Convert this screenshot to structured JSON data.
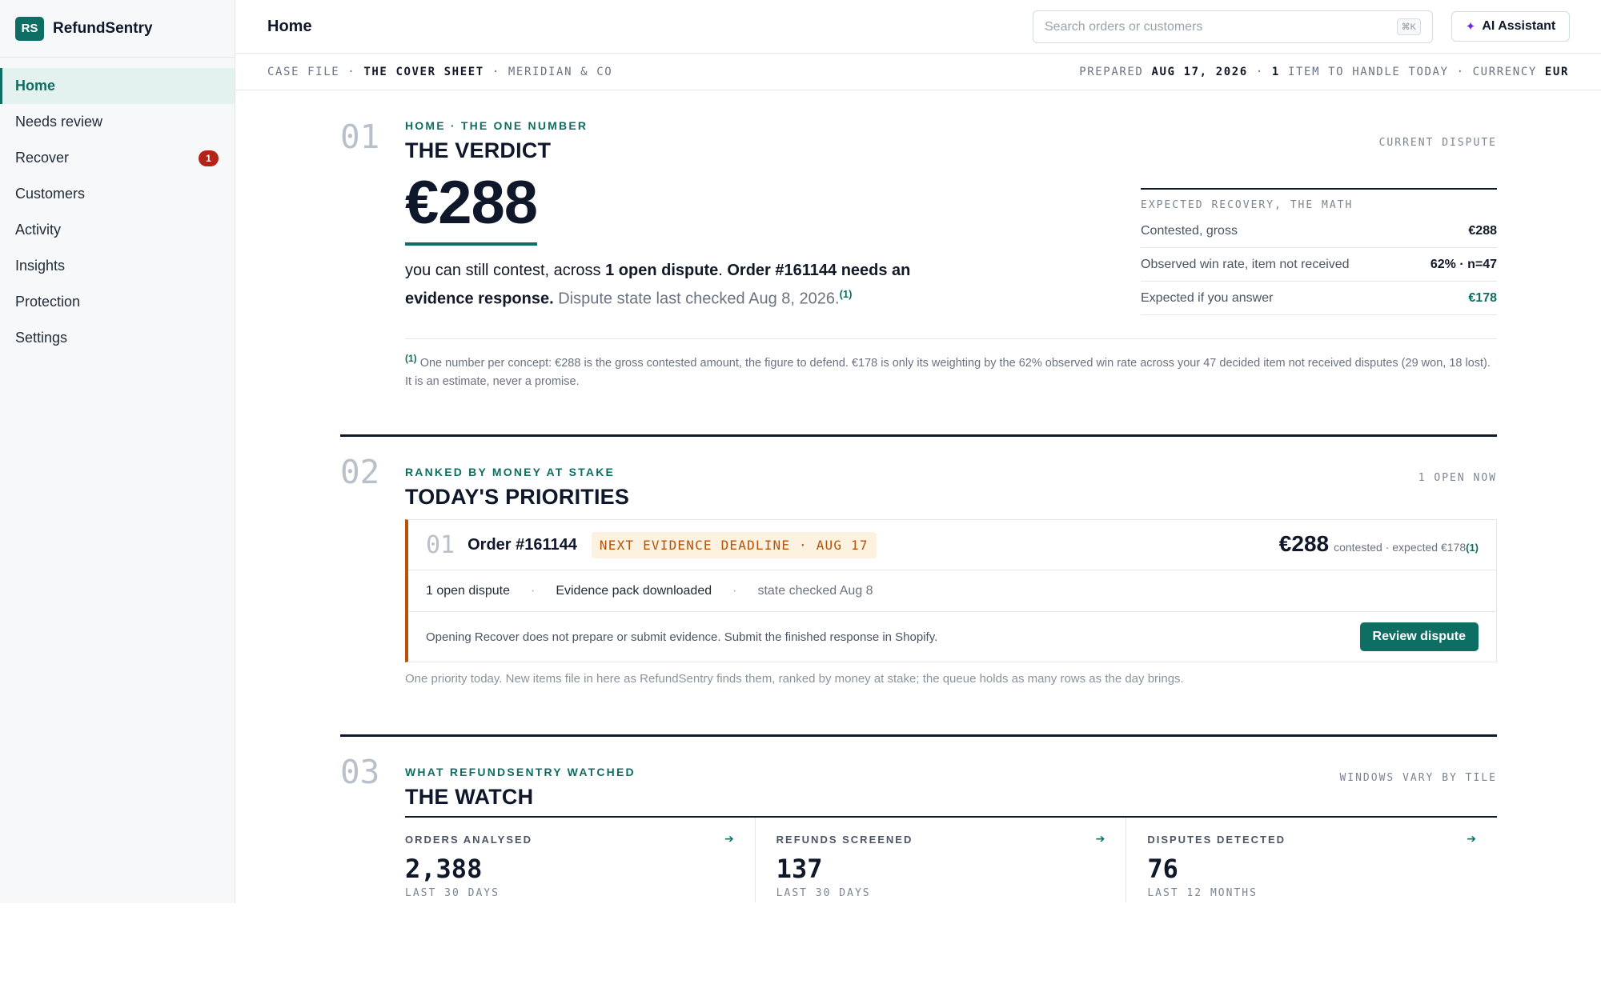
{
  "brand": {
    "logo": "RS",
    "name": "RefundSentry"
  },
  "sidebar": {
    "items": [
      {
        "label": "Home"
      },
      {
        "label": "Needs review"
      },
      {
        "label": "Recover",
        "badge": "1"
      },
      {
        "label": "Customers"
      },
      {
        "label": "Activity"
      },
      {
        "label": "Insights"
      },
      {
        "label": "Protection"
      },
      {
        "label": "Settings"
      }
    ]
  },
  "header": {
    "title": "Home",
    "search_placeholder": "Search orders or customers",
    "search_shortcut": "⌘K",
    "ai_label": "AI Assistant"
  },
  "strip": {
    "left_1": "CASE FILE · ",
    "left_2": "THE COVER SHEET",
    "left_3": " · MERIDIAN & CO",
    "right_1": "PREPARED ",
    "right_2": "AUG 17, 2026",
    "right_3": " · ",
    "right_4": "1",
    "right_5": " ITEM TO HANDLE TODAY · CURRENCY ",
    "right_6": "EUR"
  },
  "s1": {
    "num": "01",
    "eyebrow": "HOME · THE ONE NUMBER",
    "tag": "CURRENT DISPUTE",
    "title": "THE VERDICT",
    "amount": "€288",
    "text_1": "you can still contest, across ",
    "text_2": "1 open dispute",
    "text_3": ". ",
    "text_4": "Order #161144 needs an evidence response.",
    "text_5": " Dispute state last checked Aug 8, 2026.",
    "fn_mark": "(1)",
    "math": {
      "head": "EXPECTED RECOVERY, THE MATH",
      "rows": [
        {
          "label": "Contested, gross",
          "value": "€288"
        },
        {
          "label": "Observed win rate, item not received",
          "value": "62%  ·  n=47"
        },
        {
          "label": "Expected if you answer",
          "value": "€178"
        }
      ]
    },
    "footnote": " One number per concept: €288 is the gross contested amount, the figure to defend. €178 is only its weighting by the 62% observed win rate across your 47 decided item not received disputes (29 won, 18 lost). It is an estimate, never a promise."
  },
  "s2": {
    "num": "02",
    "eyebrow": "RANKED BY MONEY AT STAKE",
    "tag": "1 OPEN NOW",
    "title": "TODAY'S PRIORITIES",
    "card": {
      "rank": "01",
      "order": "Order #161144",
      "deadline": "NEXT EVIDENCE DEADLINE · AUG 17",
      "amount": "€288",
      "amount_note": "contested · expected €178",
      "fn_mark": "(1)",
      "meta_1": "1 open dispute",
      "meta_2": "Evidence pack downloaded",
      "meta_3": "state checked Aug 8",
      "sep": "·",
      "note": "Opening Recover does not prepare or submit evidence. Submit the finished response in Shopify.",
      "button": "Review dispute"
    },
    "footer": "One priority today. New items file in here as RefundSentry finds them, ranked by money at stake; the queue holds as many rows as the day brings."
  },
  "s3": {
    "num": "03",
    "eyebrow": "WHAT REFUNDSENTRY WATCHED",
    "tag": "WINDOWS VARY BY TILE",
    "title": "THE WATCH",
    "tiles": [
      {
        "label": "ORDERS ANALYSED",
        "value": "2,388",
        "sub": "LAST 30 DAYS"
      },
      {
        "label": "REFUNDS SCREENED",
        "value": "137",
        "sub": "LAST 30 DAYS"
      },
      {
        "label": "DISPUTES DETECTED",
        "value": "76",
        "sub": "LAST 12 MONTHS"
      }
    ],
    "arrow": "➔"
  },
  "icons": {
    "ai": "sparkle-icon",
    "arrow": "arrow-right-icon"
  },
  "colors": {
    "accent": "#0f6e63",
    "warning": "#b45309",
    "badge": "#b42318",
    "ai": "#6d28d9"
  }
}
